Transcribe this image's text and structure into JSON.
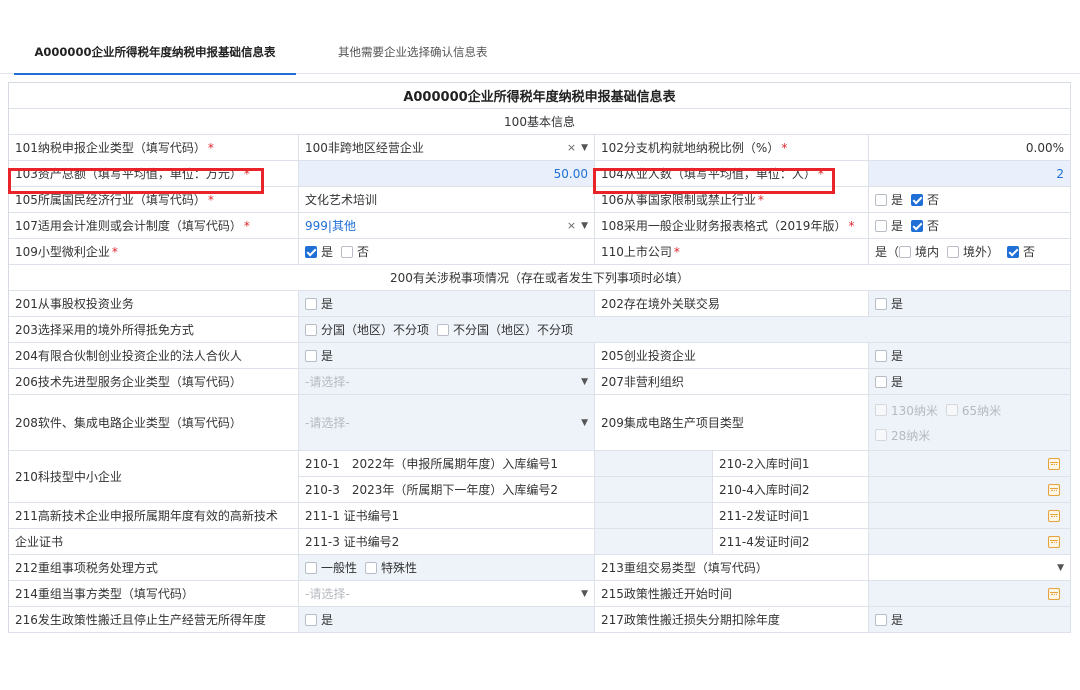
{
  "tabs": [
    "A000000企业所得税年度纳税申报基础信息表",
    "其他需要企业选择确认信息表"
  ],
  "table_title": "A000000企业所得税年度纳税申报基础信息表",
  "section_100": "100基本信息",
  "section_200": "200有关涉税事项情况（存在或者发生下列事项时必填）",
  "r101": {
    "label": "101纳税申报企业类型（填写代码）",
    "value": "100非跨地区经营企业",
    "clear": "×"
  },
  "r102": {
    "label": "102分支机构就地纳税比例（%）",
    "value": "0.00%"
  },
  "r103": {
    "label": "103资产总额（填写平均值，单位：万元）",
    "value": "50.00"
  },
  "r104": {
    "label": "104从业人数（填写平均值，单位：人）",
    "value": "2"
  },
  "r105": {
    "label": "105所属国民经济行业（填写代码）",
    "value": "文化艺术培训"
  },
  "r106": {
    "label": "106从事国家限制或禁止行业",
    "opt_yes": "是",
    "opt_no": "否"
  },
  "r107": {
    "label": "107适用会计准则或会计制度（填写代码）",
    "value": "999|其他",
    "clear": "×"
  },
  "r108": {
    "label": "108采用一般企业财务报表格式（2019年版）",
    "opt_yes": "是",
    "opt_no": "否"
  },
  "r109": {
    "label": "109小型微利企业",
    "opt_yes": "是",
    "opt_no": "否"
  },
  "r110": {
    "label": "110上市公司",
    "prefix": "是（",
    "opt_in": "境内",
    "opt_out": "境外）",
    "opt_no": "否"
  },
  "r201": {
    "label": "201从事股权投资业务",
    "opt": "是"
  },
  "r202": {
    "label": "202存在境外关联交易",
    "opt": "是"
  },
  "r203": {
    "label": "203选择采用的境外所得抵免方式",
    "opt_a": "分国（地区）不分项",
    "opt_b": "不分国（地区）不分项"
  },
  "r204": {
    "label": "204有限合伙制创业投资企业的法人合伙人",
    "opt": "是"
  },
  "r205": {
    "label": "205创业投资企业",
    "opt": "是"
  },
  "r206": {
    "label": "206技术先进型服务企业类型（填写代码）",
    "placeholder": "-请选择-"
  },
  "r207": {
    "label": "207非营利组织",
    "opt": "是"
  },
  "r208": {
    "label": "208软件、集成电路企业类型（填写代码）",
    "placeholder": "-请选择-"
  },
  "r209": {
    "label": "209集成电路生产项目类型",
    "opt_a": "130纳米",
    "opt_b": "65纳米",
    "opt_c": "28纳米"
  },
  "r210": {
    "label": "210科技型中小企业",
    "l1": "210-1　2022年（申报所属期年度）入库编号1",
    "l2": "210-2入库时间1",
    "l3": "210-3　2023年（所属期下一年度）入库编号2",
    "l4": "210-4入库时间2"
  },
  "r211": {
    "label_a": "211高新技术企业申报所属期年度有效的高新技术",
    "label_b": "企业证书",
    "l1": "211-1 证书编号1",
    "l2": "211-2发证时间1",
    "l3": "211-3 证书编号2",
    "l4": "211-4发证时间2"
  },
  "r212": {
    "label": "212重组事项税务处理方式",
    "opt_a": "一般性",
    "opt_b": "特殊性"
  },
  "r213": {
    "label": "213重组交易类型（填写代码）"
  },
  "r214": {
    "label": "214重组当事方类型（填写代码）",
    "placeholder": "-请选择-"
  },
  "r215": {
    "label": "215政策性搬迁开始时间"
  },
  "r216": {
    "label": "216发生政策性搬迁且停止生产经营无所得年度",
    "opt": "是"
  },
  "r217": {
    "label": "217政策性搬迁损失分期扣除年度",
    "opt": "是"
  },
  "required_mark": "*",
  "colors": {
    "accent": "#1f6fd6",
    "required": "#e0262a",
    "highlight": "#e8232a",
    "calendar": "#e6a23c"
  }
}
